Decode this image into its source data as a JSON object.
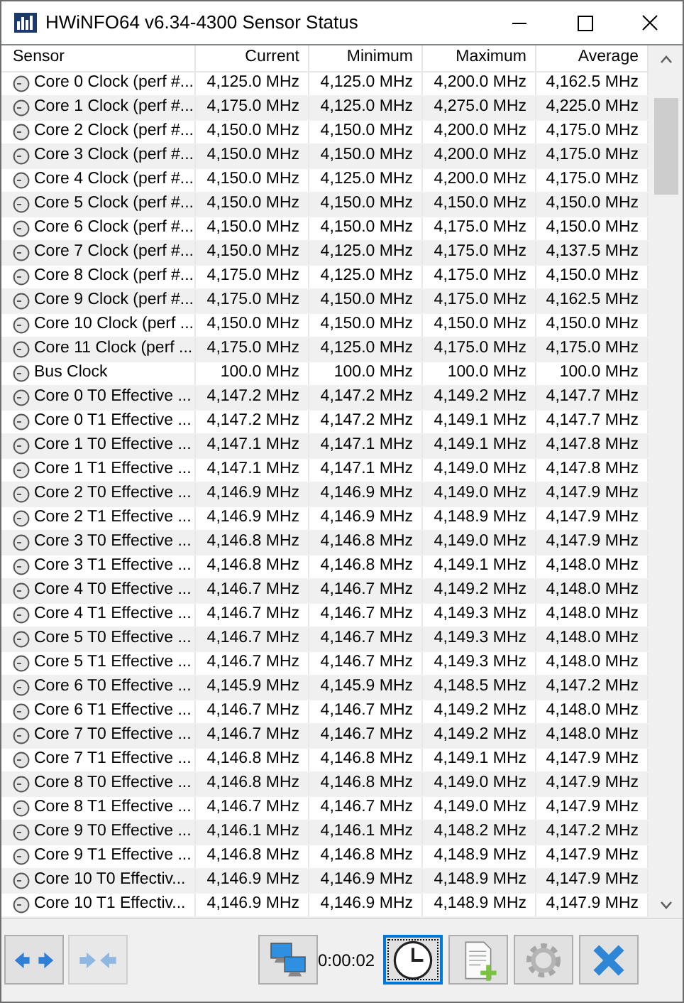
{
  "window": {
    "title": "HWiNFO64 v6.34-4300 Sensor Status"
  },
  "table": {
    "columns": [
      "Sensor",
      "Current",
      "Minimum",
      "Maximum",
      "Average"
    ],
    "rows": [
      [
        "Core 0 Clock (perf #...",
        "4,125.0 MHz",
        "4,125.0 MHz",
        "4,200.0 MHz",
        "4,162.5 MHz"
      ],
      [
        "Core 1 Clock (perf #...",
        "4,175.0 MHz",
        "4,125.0 MHz",
        "4,275.0 MHz",
        "4,225.0 MHz"
      ],
      [
        "Core 2 Clock (perf #...",
        "4,150.0 MHz",
        "4,150.0 MHz",
        "4,200.0 MHz",
        "4,175.0 MHz"
      ],
      [
        "Core 3 Clock (perf #...",
        "4,150.0 MHz",
        "4,150.0 MHz",
        "4,200.0 MHz",
        "4,175.0 MHz"
      ],
      [
        "Core 4 Clock (perf #...",
        "4,150.0 MHz",
        "4,125.0 MHz",
        "4,200.0 MHz",
        "4,175.0 MHz"
      ],
      [
        "Core 5 Clock (perf #...",
        "4,150.0 MHz",
        "4,150.0 MHz",
        "4,150.0 MHz",
        "4,150.0 MHz"
      ],
      [
        "Core 6 Clock (perf #...",
        "4,150.0 MHz",
        "4,150.0 MHz",
        "4,175.0 MHz",
        "4,150.0 MHz"
      ],
      [
        "Core 7 Clock (perf #...",
        "4,150.0 MHz",
        "4,125.0 MHz",
        "4,175.0 MHz",
        "4,137.5 MHz"
      ],
      [
        "Core 8 Clock (perf #...",
        "4,175.0 MHz",
        "4,125.0 MHz",
        "4,175.0 MHz",
        "4,150.0 MHz"
      ],
      [
        "Core 9 Clock (perf #...",
        "4,175.0 MHz",
        "4,150.0 MHz",
        "4,175.0 MHz",
        "4,162.5 MHz"
      ],
      [
        "Core 10 Clock (perf ...",
        "4,150.0 MHz",
        "4,150.0 MHz",
        "4,150.0 MHz",
        "4,150.0 MHz"
      ],
      [
        "Core 11 Clock (perf ...",
        "4,175.0 MHz",
        "4,125.0 MHz",
        "4,175.0 MHz",
        "4,175.0 MHz"
      ],
      [
        "Bus Clock",
        "100.0 MHz",
        "100.0 MHz",
        "100.0 MHz",
        "100.0 MHz"
      ],
      [
        "Core 0 T0 Effective ...",
        "4,147.2 MHz",
        "4,147.2 MHz",
        "4,149.2 MHz",
        "4,147.7 MHz"
      ],
      [
        "Core 0 T1 Effective ...",
        "4,147.2 MHz",
        "4,147.2 MHz",
        "4,149.1 MHz",
        "4,147.7 MHz"
      ],
      [
        "Core 1 T0 Effective ...",
        "4,147.1 MHz",
        "4,147.1 MHz",
        "4,149.1 MHz",
        "4,147.8 MHz"
      ],
      [
        "Core 1 T1 Effective ...",
        "4,147.1 MHz",
        "4,147.1 MHz",
        "4,149.0 MHz",
        "4,147.8 MHz"
      ],
      [
        "Core 2 T0 Effective ...",
        "4,146.9 MHz",
        "4,146.9 MHz",
        "4,149.0 MHz",
        "4,147.9 MHz"
      ],
      [
        "Core 2 T1 Effective ...",
        "4,146.9 MHz",
        "4,146.9 MHz",
        "4,148.9 MHz",
        "4,147.9 MHz"
      ],
      [
        "Core 3 T0 Effective ...",
        "4,146.8 MHz",
        "4,146.8 MHz",
        "4,149.0 MHz",
        "4,147.9 MHz"
      ],
      [
        "Core 3 T1 Effective ...",
        "4,146.8 MHz",
        "4,146.8 MHz",
        "4,149.1 MHz",
        "4,148.0 MHz"
      ],
      [
        "Core 4 T0 Effective ...",
        "4,146.7 MHz",
        "4,146.7 MHz",
        "4,149.2 MHz",
        "4,148.0 MHz"
      ],
      [
        "Core 4 T1 Effective ...",
        "4,146.7 MHz",
        "4,146.7 MHz",
        "4,149.3 MHz",
        "4,148.0 MHz"
      ],
      [
        "Core 5 T0 Effective ...",
        "4,146.7 MHz",
        "4,146.7 MHz",
        "4,149.3 MHz",
        "4,148.0 MHz"
      ],
      [
        "Core 5 T1 Effective ...",
        "4,146.7 MHz",
        "4,146.7 MHz",
        "4,149.3 MHz",
        "4,148.0 MHz"
      ],
      [
        "Core 6 T0 Effective ...",
        "4,145.9 MHz",
        "4,145.9 MHz",
        "4,148.5 MHz",
        "4,147.2 MHz"
      ],
      [
        "Core 6 T1 Effective ...",
        "4,146.7 MHz",
        "4,146.7 MHz",
        "4,149.2 MHz",
        "4,148.0 MHz"
      ],
      [
        "Core 7 T0 Effective ...",
        "4,146.7 MHz",
        "4,146.7 MHz",
        "4,149.2 MHz",
        "4,148.0 MHz"
      ],
      [
        "Core 7 T1 Effective ...",
        "4,146.8 MHz",
        "4,146.8 MHz",
        "4,149.1 MHz",
        "4,147.9 MHz"
      ],
      [
        "Core 8 T0 Effective ...",
        "4,146.8 MHz",
        "4,146.8 MHz",
        "4,149.0 MHz",
        "4,147.9 MHz"
      ],
      [
        "Core 8 T1 Effective ...",
        "4,146.7 MHz",
        "4,146.7 MHz",
        "4,149.0 MHz",
        "4,147.9 MHz"
      ],
      [
        "Core 9 T0 Effective ...",
        "4,146.1 MHz",
        "4,146.1 MHz",
        "4,148.2 MHz",
        "4,147.2 MHz"
      ],
      [
        "Core 9 T1 Effective ...",
        "4,146.8 MHz",
        "4,146.8 MHz",
        "4,148.9 MHz",
        "4,147.9 MHz"
      ],
      [
        "Core 10 T0 Effectiv...",
        "4,146.9 MHz",
        "4,146.9 MHz",
        "4,148.9 MHz",
        "4,147.9 MHz"
      ],
      [
        "Core 10 T1 Effectiv...",
        "4,146.9 MHz",
        "4,146.9 MHz",
        "4,148.9 MHz",
        "4,147.9 MHz"
      ]
    ]
  },
  "toolbar": {
    "buttons": [
      {
        "kind": "expand",
        "disabled": false,
        "selected": false
      },
      {
        "kind": "collapse",
        "disabled": true,
        "selected": false
      },
      {
        "kind": "network",
        "disabled": false,
        "selected": false
      },
      {
        "kind": "timer",
        "disabled": false,
        "selected": true
      },
      {
        "kind": "report",
        "disabled": false,
        "selected": false
      },
      {
        "kind": "settings",
        "disabled": false,
        "selected": false
      },
      {
        "kind": "close",
        "disabled": false,
        "selected": false
      }
    ],
    "elapsed": "0:00:02"
  }
}
